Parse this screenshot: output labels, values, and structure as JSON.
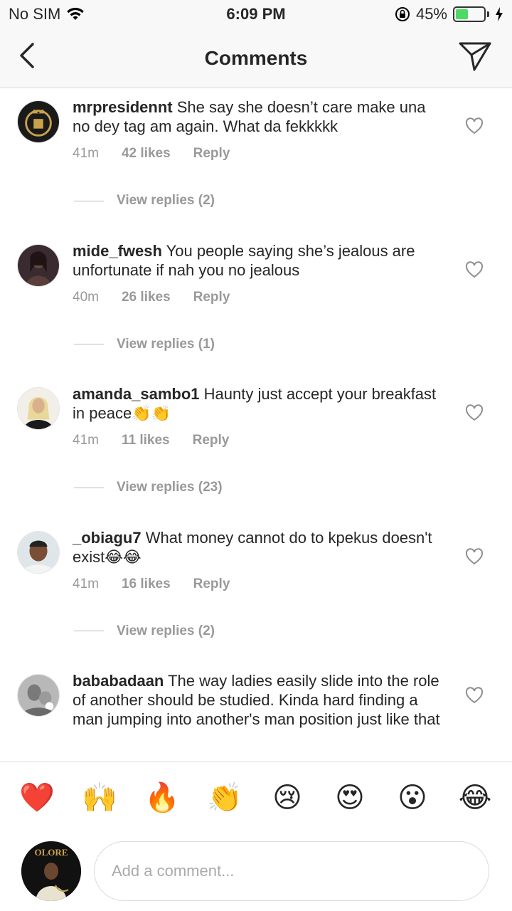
{
  "status_bar": {
    "carrier": "No SIM",
    "time": "6:09 PM",
    "battery": "45%",
    "battery_level": 0.45
  },
  "nav": {
    "title": "Comments",
    "back_icon": "chevron-left-icon",
    "share_icon": "paper-plane-icon"
  },
  "comments": [
    {
      "username": "mrpresidennt",
      "text": "She say she doesn’t care make una no dey tag am again. What da fekkkkk",
      "time": "41m",
      "likes": "42 likes",
      "reply": "Reply",
      "view_replies": "View replies (2)"
    },
    {
      "username": "mide_fwesh",
      "text": "You people saying she’s jealous are unfortunate if nah you no jealous",
      "time": "40m",
      "likes": "26 likes",
      "reply": "Reply",
      "view_replies": "View replies (1)"
    },
    {
      "username": "amanda_sambo1",
      "text": "Haunty just accept your breakfast in peace👏👏",
      "time": "41m",
      "likes": "11 likes",
      "reply": "Reply",
      "view_replies": "View replies (23)"
    },
    {
      "username": "_obiagu7",
      "text": "What money cannot do to kpekus doesn't exist😂😂",
      "time": "41m",
      "likes": "16 likes",
      "reply": "Reply",
      "view_replies": "View replies (2)"
    },
    {
      "username": "bababadaan",
      "text": "The way ladies easily slide into the role of another should be studied. Kinda hard finding a man jumping into another's man position just like that"
    }
  ],
  "emoji_bar": [
    "❤️",
    "🙌",
    "🔥",
    "👏",
    "😢",
    "😍",
    "😮",
    "😂"
  ],
  "input": {
    "placeholder": "Add a comment..."
  },
  "me_avatar_text": "OLORE"
}
